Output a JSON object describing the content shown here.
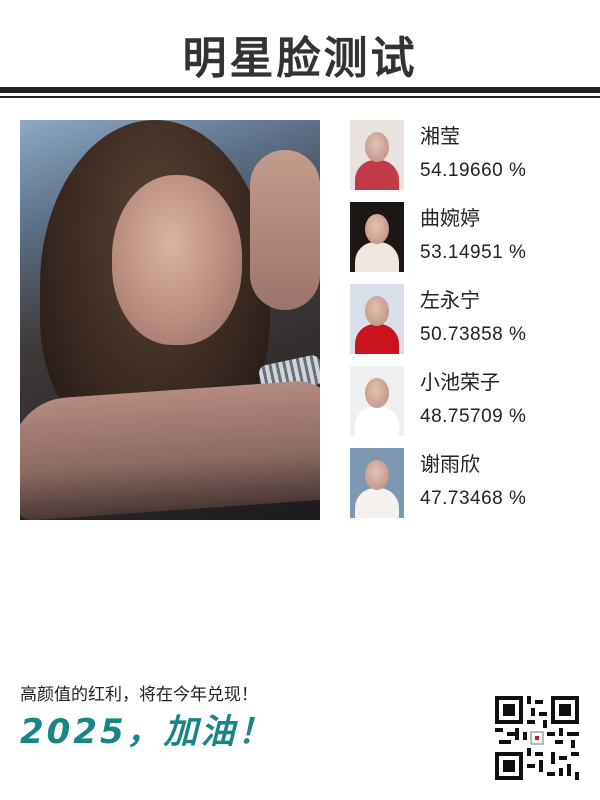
{
  "page": {
    "title": "明星脸测试"
  },
  "photo": {
    "icon": "portrait-photo"
  },
  "results": [
    {
      "name": "湘莹",
      "score": "54.19660 %",
      "thumb_bg": "#e9e3df",
      "thumb_top": "#c23a45"
    },
    {
      "name": "曲婉婷",
      "score": "53.14951 %",
      "thumb_bg": "#1c1714",
      "thumb_top": "#f0e6dd"
    },
    {
      "name": "左永宁",
      "score": "50.73858 %",
      "thumb_bg": "#d9dfe8",
      "thumb_top": "#c9141e"
    },
    {
      "name": "小池荣子",
      "score": "48.75709 %",
      "thumb_bg": "#eef0f1",
      "thumb_top": "#ffffff"
    },
    {
      "name": "谢雨欣",
      "score": "47.73468 %",
      "thumb_bg": "#7e98b2",
      "thumb_top": "#f4f1ee"
    }
  ],
  "footer": {
    "slogan": "高颜值的红利，将在今年兑现！",
    "year": "2025，加油！",
    "qr_icon": "qr-code-icon"
  },
  "colors": {
    "accent": "#1a8585",
    "title": "#333333"
  }
}
